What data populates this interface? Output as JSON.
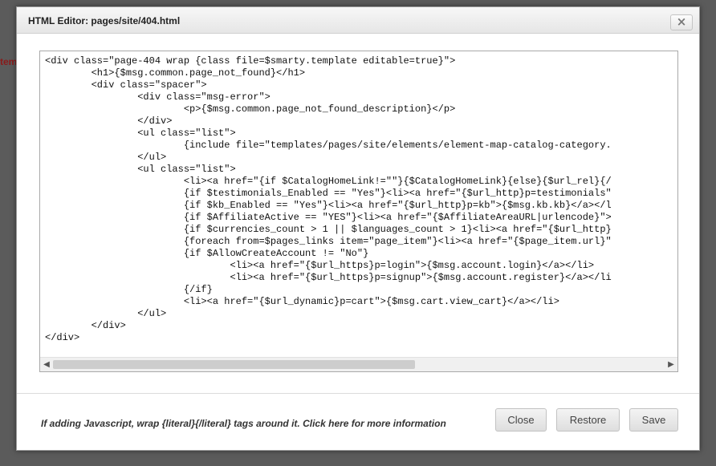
{
  "backdrop": {
    "text": "tem"
  },
  "dialog": {
    "title": "HTML Editor: pages/site/404.html",
    "close_icon": "×"
  },
  "editor": {
    "code_lines": [
      "<div class=\"page-404 wrap {class file=$smarty.template editable=true}\">",
      "        <h1>{$msg.common.page_not_found}</h1>",
      "        <div class=\"spacer\">",
      "                <div class=\"msg-error\">",
      "                        <p>{$msg.common.page_not_found_description}</p>",
      "                </div>",
      "                <ul class=\"list\">",
      "                        {include file=\"templates/pages/site/elements/element-map-catalog-category.",
      "                </ul>",
      "                <ul class=\"list\">",
      "                        <li><a href=\"{if $CatalogHomeLink!=\"\"}{$CatalogHomeLink}{else}{$url_rel}{/",
      "                        {if $testimonials_Enabled == \"Yes\"}<li><a href=\"{$url_http}p=testimonials\"",
      "                        {if $kb_Enabled == \"Yes\"}<li><a href=\"{$url_http}p=kb\">{$msg.kb.kb}</a></l",
      "                        {if $AffiliateActive == \"YES\"}<li><a href=\"{$AffiliateAreaURL|urlencode}\">",
      "                        {if $currencies_count > 1 || $languages_count > 1}<li><a href=\"{$url_http}",
      "                        {foreach from=$pages_links item=\"page_item\"}<li><a href=\"{$page_item.url}\"",
      "                        {if $AllowCreateAccount != \"No\"}",
      "                                <li><a href=\"{$url_https}p=login\">{$msg.account.login}</a></li>",
      "                                <li><a href=\"{$url_https}p=signup\">{$msg.account.register}</a></li",
      "                        {/if}",
      "                        <li><a href=\"{$url_dynamic}p=cart\">{$msg.cart.view_cart}</a></li>",
      "                </ul>",
      "        </div>",
      "</div>"
    ],
    "scroll_left_icon": "◀",
    "scroll_right_icon": "▶"
  },
  "footer": {
    "hint": "If adding Javascript, wrap {literal}{/literal} tags around it. Click here for more information",
    "buttons": {
      "close": "Close",
      "restore": "Restore",
      "save": "Save"
    }
  },
  "colors": {
    "backdrop": "#5b5b5b",
    "backdrop_text": "#8a1a1a"
  }
}
